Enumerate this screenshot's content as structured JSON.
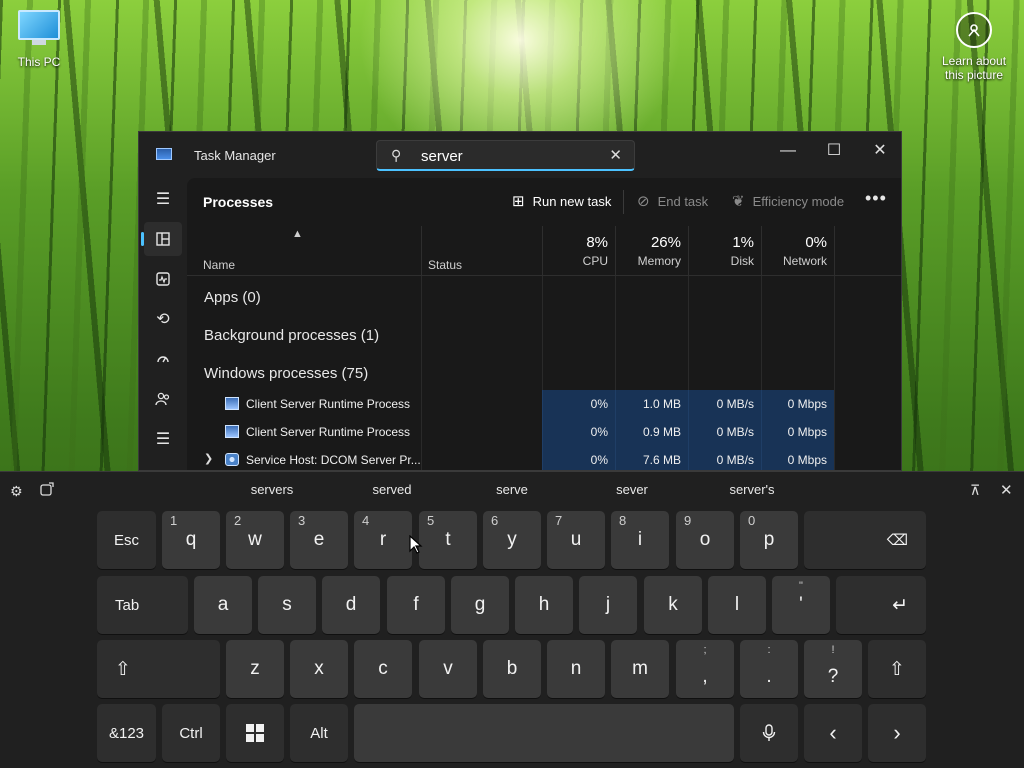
{
  "desktop": {
    "this_pc_label": "This PC",
    "learn_label_1": "Learn about",
    "learn_label_2": "this picture"
  },
  "task_manager": {
    "title": "Task Manager",
    "search_value": "server",
    "page_title": "Processes",
    "toolbar": {
      "run_new_task": "Run new task",
      "end_task": "End task",
      "efficiency_mode": "Efficiency mode",
      "more": "•••"
    },
    "columns": {
      "name": "Name",
      "status": "Status",
      "cpu_pct": "8%",
      "cpu": "CPU",
      "memory_pct": "26%",
      "memory": "Memory",
      "disk_pct": "1%",
      "disk": "Disk",
      "network_pct": "0%",
      "network": "Network"
    },
    "groups": {
      "apps": "Apps (0)",
      "background": "Background processes (1)",
      "windows": "Windows processes (75)"
    },
    "rows": [
      {
        "name": "Client Server Runtime Process",
        "cpu": "0%",
        "memory": "1.0 MB",
        "disk": "0 MB/s",
        "network": "0 Mbps"
      },
      {
        "name": "Client Server Runtime Process",
        "cpu": "0%",
        "memory": "0.9 MB",
        "disk": "0 MB/s",
        "network": "0 Mbps"
      },
      {
        "name": "Service Host: DCOM Server Pr...",
        "cpu": "0%",
        "memory": "7.6 MB",
        "disk": "0 MB/s",
        "network": "0 Mbps"
      }
    ]
  },
  "keyboard": {
    "suggestions": [
      "servers",
      "served",
      "serve",
      "sever",
      "server's"
    ],
    "row1": {
      "esc": "Esc",
      "keys": [
        {
          "num": "1",
          "letter": "q"
        },
        {
          "num": "2",
          "letter": "w"
        },
        {
          "num": "3",
          "letter": "e"
        },
        {
          "num": "4",
          "letter": "r"
        },
        {
          "num": "5",
          "letter": "t"
        },
        {
          "num": "6",
          "letter": "y"
        },
        {
          "num": "7",
          "letter": "u"
        },
        {
          "num": "8",
          "letter": "i"
        },
        {
          "num": "9",
          "letter": "o"
        },
        {
          "num": "0",
          "letter": "p"
        }
      ],
      "backspace": "⌫"
    },
    "row2": {
      "tab": "Tab",
      "keys": [
        "a",
        "s",
        "d",
        "f",
        "g",
        "h",
        "j",
        "k",
        "l"
      ],
      "apostrophe_top": "\"",
      "apostrophe": "'",
      "enter": "↵"
    },
    "row3": {
      "shift": "⇧",
      "keys": [
        "z",
        "x",
        "c",
        "v",
        "b",
        "n",
        "m"
      ],
      "comma_top": ";",
      "comma": ",",
      "period_top": ":",
      "period": ".",
      "question_top": "!",
      "question": "?"
    },
    "row4": {
      "symbols": "&123",
      "ctrl": "Ctrl",
      "alt": "Alt",
      "mic": "🎤",
      "left": "‹",
      "right": "›"
    }
  }
}
